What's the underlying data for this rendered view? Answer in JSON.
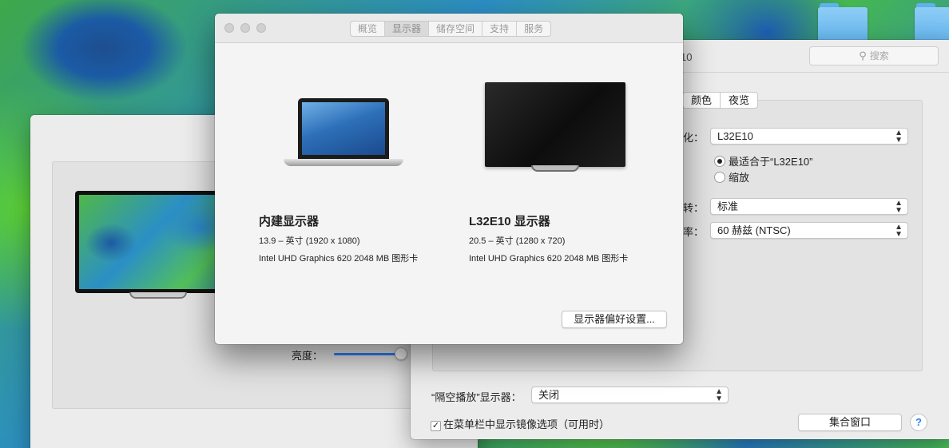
{
  "front_window": {
    "tabs": [
      "概览",
      "显示器",
      "储存空间",
      "支持",
      "服务"
    ],
    "active_tab_index": 1,
    "displays": [
      {
        "name": "内建显示器",
        "size_line": "13.9 – 英寸 (1920 x 1080)",
        "gpu_line": "Intel UHD Graphics 620 2048 MB 图形卡",
        "icon": "laptop-icon"
      },
      {
        "name": "L32E10 显示器",
        "size_line": "20.5 – 英寸 (1280 x 720)",
        "gpu_line": "Intel UHD Graphics 620 2048 MB 图形卡",
        "icon": "tv-icon"
      }
    ],
    "prefs_button_label": "显示器偏好设置..."
  },
  "left_window": {
    "brightness_label": "亮度：",
    "brightness_value": 0.93
  },
  "right_window": {
    "title_fragment": "10",
    "search_placeholder": "搜索",
    "segments": [
      "颜色",
      "夜览"
    ],
    "optimize_label": "化：",
    "optimize_value": "L32E10",
    "resolution_options": [
      {
        "label": "最适合于“L32E10”",
        "selected": true
      },
      {
        "label": "缩放",
        "selected": false
      }
    ],
    "rotation_label": "转：",
    "rotation_value": "标准",
    "refresh_label": "率：",
    "refresh_value": "60 赫兹 (NTSC)",
    "airplay_label": "“隔空播放”显示器：",
    "airplay_value": "关闭",
    "mirror_checkbox_label": "在菜单栏中显示镜像选项（可用时）",
    "mirror_checked": true,
    "gather_button_label": "集合窗口",
    "help_label": "?"
  },
  "colors": {
    "accent": "#2e7cf6",
    "window_bg": "#ececec"
  }
}
